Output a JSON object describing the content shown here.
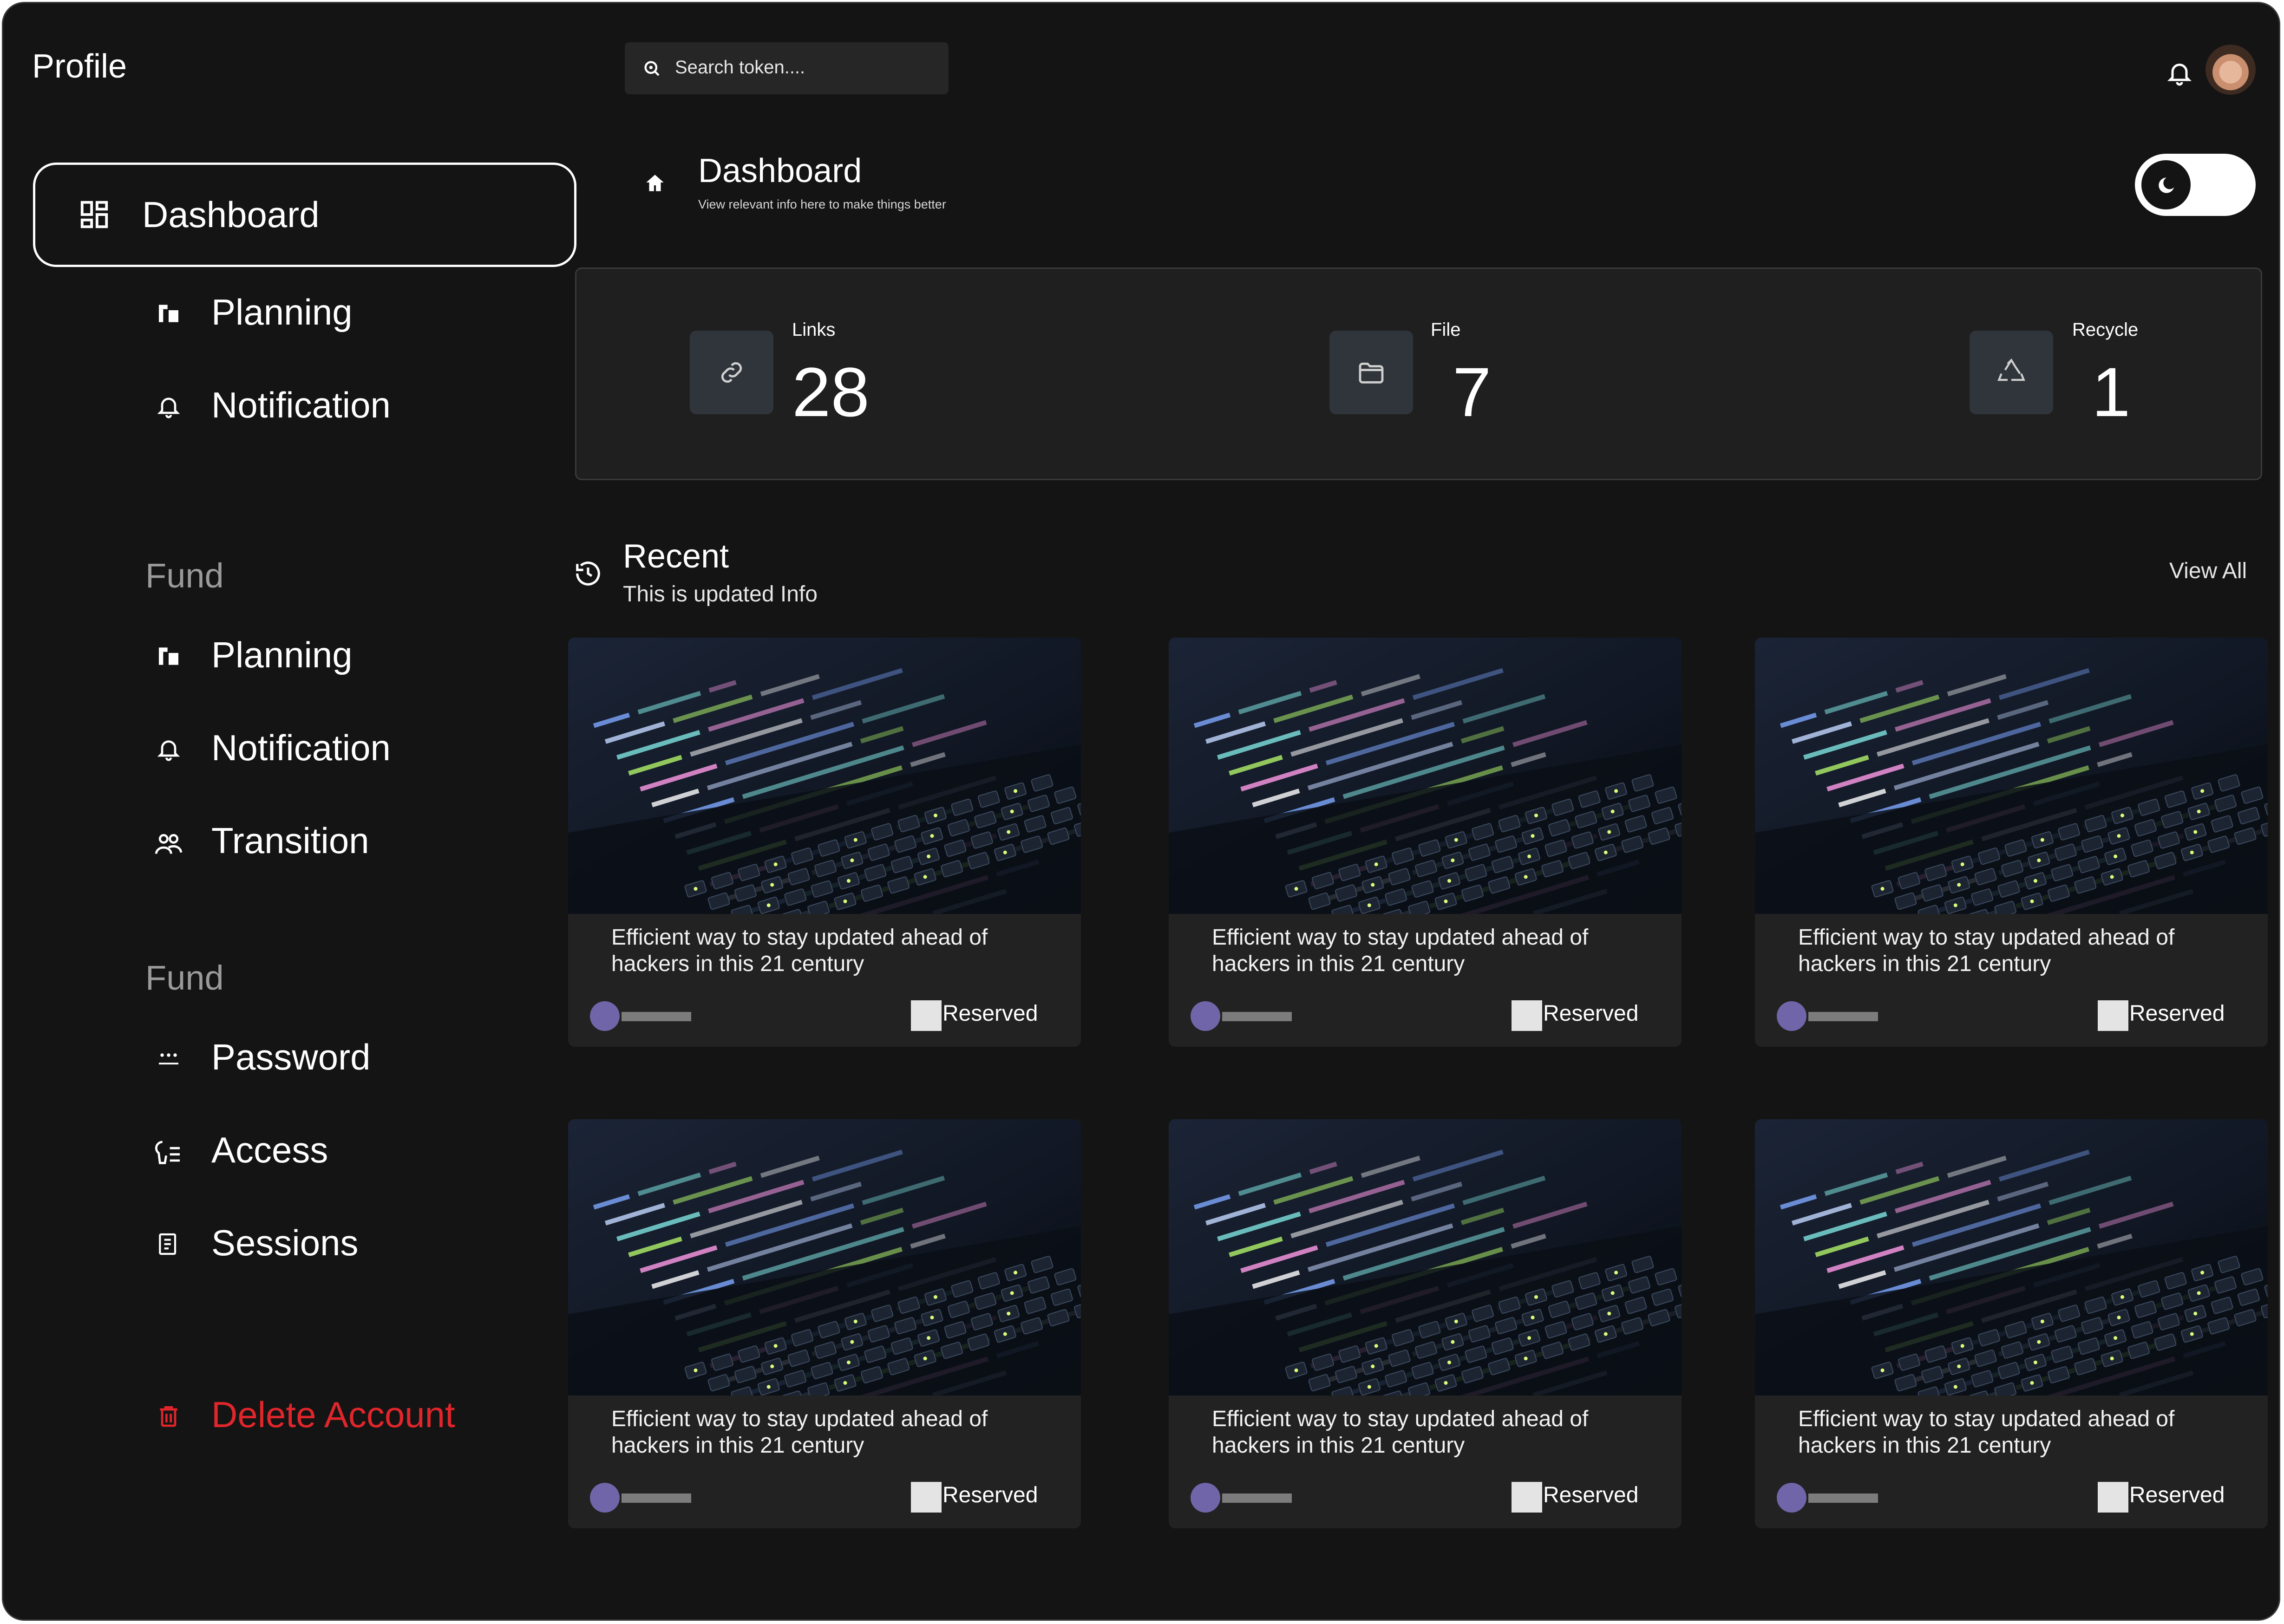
{
  "app": {
    "title": "Profile"
  },
  "search": {
    "placeholder": "Search token...."
  },
  "sidebar": {
    "active": {
      "label": "Dashboard",
      "icon": "dashboard-icon"
    },
    "group1": [
      {
        "label": "Planning",
        "icon": "planning-icon"
      },
      {
        "label": "Notification",
        "icon": "bell-icon"
      }
    ],
    "section2": "Fund",
    "group2": [
      {
        "label": "Planning",
        "icon": "planning-icon"
      },
      {
        "label": "Notification",
        "icon": "bell-icon"
      },
      {
        "label": "Transition",
        "icon": "users-icon"
      }
    ],
    "section3": "Fund",
    "group3": [
      {
        "label": "Password",
        "icon": "password-icon"
      },
      {
        "label": "Access",
        "icon": "access-icon"
      },
      {
        "label": "Sessions",
        "icon": "sessions-icon"
      }
    ],
    "delete": {
      "label": "Delete Account",
      "icon": "trash-icon",
      "color": "#e0262b"
    }
  },
  "header": {
    "title": "Dashboard",
    "subtitle": "View relevant info here to make things better"
  },
  "stats": [
    {
      "label": "Links",
      "value": "28",
      "icon": "link-icon"
    },
    {
      "label": "File",
      "value": "7",
      "icon": "folder-icon"
    },
    {
      "label": "Recycle",
      "value": "1",
      "icon": "recycle-icon"
    }
  ],
  "recent": {
    "title": "Recent",
    "subtitle": "This is updated Info",
    "view_all": "View All",
    "cards": [
      {
        "title": "Efficient way to stay updated ahead of hackers in this 21 century",
        "badge": "Reserved"
      },
      {
        "title": "Efficient way to stay updated ahead of hackers in this 21 century",
        "badge": "Reserved"
      },
      {
        "title": "Efficient way to stay updated ahead of hackers in this 21 century",
        "badge": "Reserved"
      },
      {
        "title": "Efficient way to stay updated ahead of hackers in this 21 century",
        "badge": "Reserved"
      },
      {
        "title": "Efficient way to stay updated ahead of hackers in this 21 century",
        "badge": "Reserved"
      },
      {
        "title": "Efficient way to stay updated ahead of hackers in this 21 century",
        "badge": "Reserved"
      }
    ]
  },
  "colors": {
    "background": "#141414",
    "card": "#222222",
    "stat_tile": "#2f353a",
    "danger": "#e0262b",
    "avatar_accent": "#7065a8"
  }
}
